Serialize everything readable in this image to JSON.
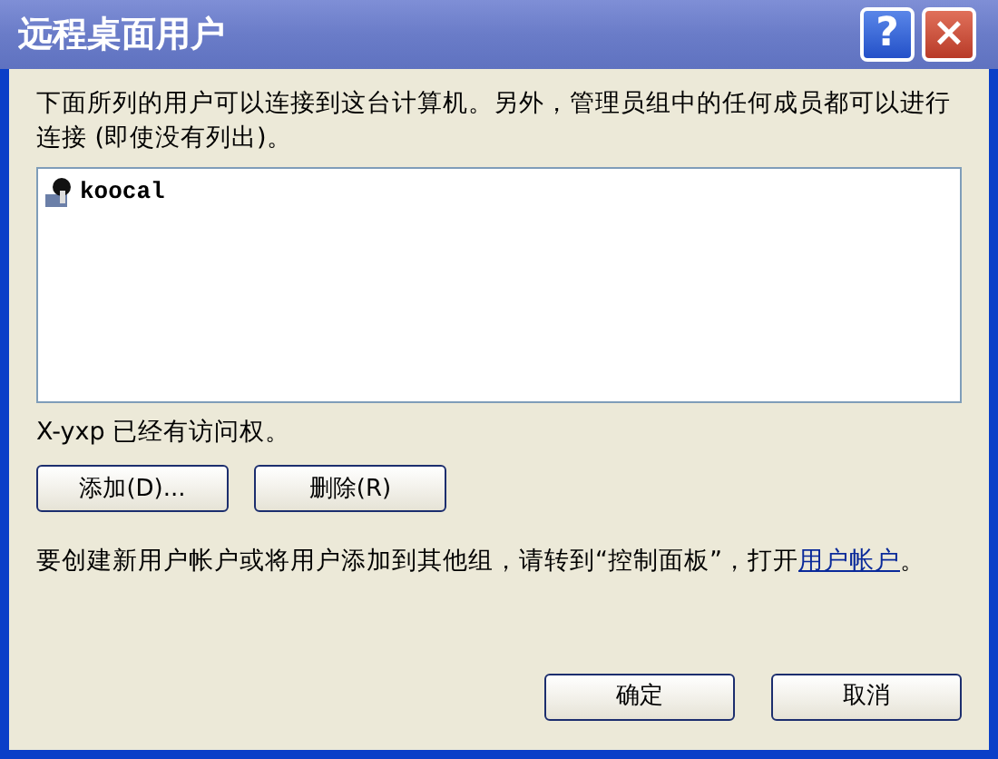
{
  "window": {
    "title": "远程桌面用户"
  },
  "title_buttons": [
    {
      "kind": "help",
      "label": "?"
    },
    {
      "kind": "close",
      "label": "×"
    }
  ],
  "intro": "下面所列的用户可以连接到这台计算机。另外，管理员组中的任何成员都可以进行连接 (即使没有列出)。",
  "users": [
    {
      "name": "koocal",
      "selected": false
    }
  ],
  "access_note": "X-yxp 已经有访问权。",
  "list_buttons": [
    "添加(D)...",
    "删除(R)"
  ],
  "footer": {
    "before": "要创建新用户帐户或将用户添加到其他组，请转到“控制面板”，打开",
    "link": "用户帐户",
    "after": "。"
  },
  "dialog_buttons": [
    "确定",
    "取消"
  ]
}
